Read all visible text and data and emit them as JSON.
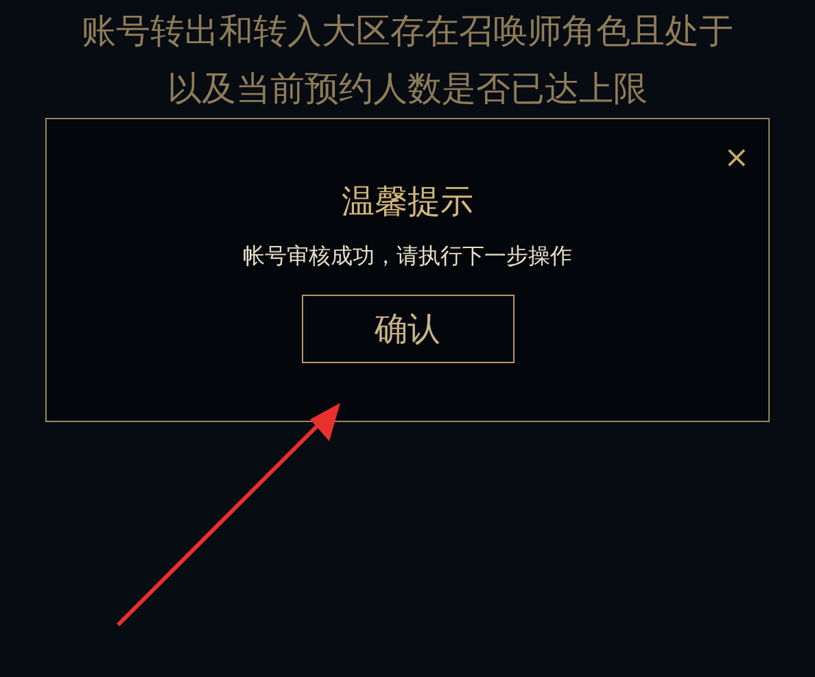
{
  "background_text": [
    "账号转出和转入大区存在召唤师角色且处于",
    "以及当前预约人数是否已达上限"
  ],
  "dialog": {
    "close": "×",
    "title": "温馨提示",
    "message": "帐号审核成功，请执行下一步操作",
    "button": "确认"
  }
}
